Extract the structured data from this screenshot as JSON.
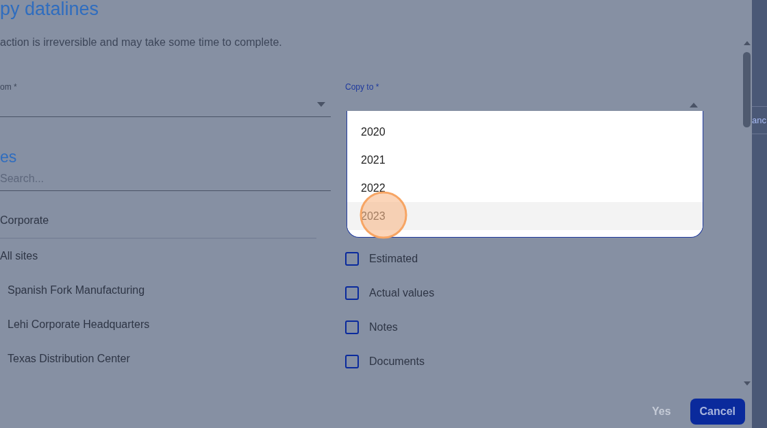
{
  "dialog": {
    "title": "py datalines",
    "description": "action is irreversible and may take some time to complete."
  },
  "copy_from": {
    "label": "om *"
  },
  "copy_to": {
    "label": "Copy to *",
    "expanded": true,
    "options": [
      {
        "label": "2020",
        "selected": false
      },
      {
        "label": "2021",
        "selected": false
      },
      {
        "label": "2022",
        "selected": false
      },
      {
        "label": "2023",
        "selected": true
      }
    ]
  },
  "sites": {
    "heading": "es",
    "search": {
      "placeholder": "Search..."
    },
    "tree": [
      {
        "label": "Corporate"
      },
      {
        "label": "All sites",
        "children": [
          {
            "label": "Spanish Fork Manufacturing"
          },
          {
            "label": "Lehi Corporate Headquarters"
          },
          {
            "label": "Texas Distribution Center"
          }
        ]
      }
    ]
  },
  "data_options": [
    {
      "label": "Estimated",
      "checked": false
    },
    {
      "label": "Actual values",
      "checked": false
    },
    {
      "label": "Notes",
      "checked": false
    },
    {
      "label": "Documents",
      "checked": false
    }
  ],
  "buttons": [
    {
      "label": "Yes",
      "disabled": true
    },
    {
      "label": "Cancel",
      "disabled": false
    }
  ],
  "background_tab": {
    "label": "anc"
  }
}
